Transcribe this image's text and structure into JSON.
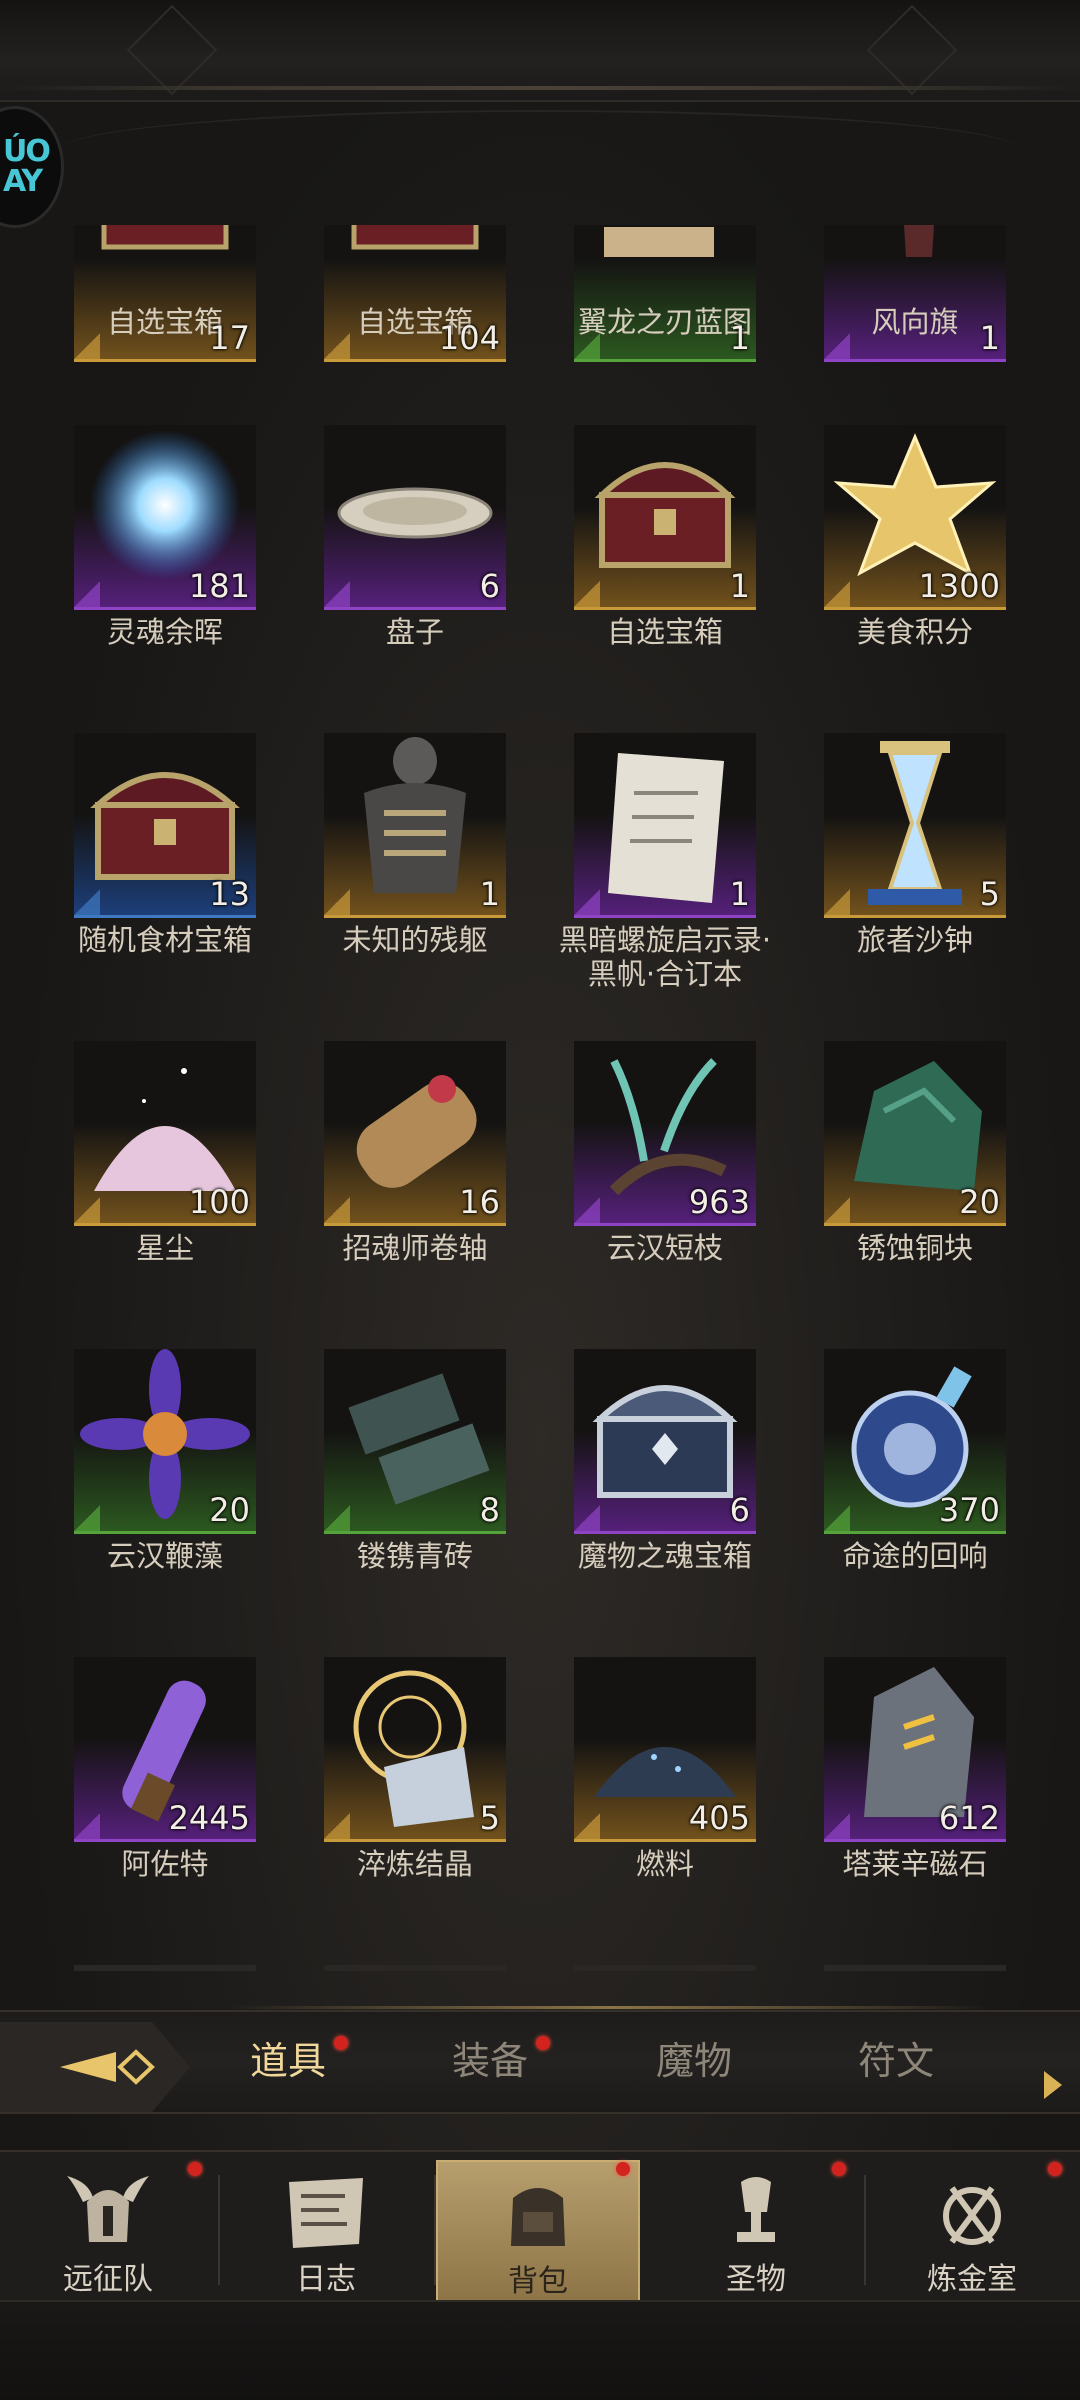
{
  "colors": {
    "rarity_orange": "#c99a3a",
    "rarity_purple": "#8f43c5",
    "rarity_green": "#55a43b",
    "rarity_blue": "#3e79c2",
    "tab_active": "#f0d79a",
    "notification_dot": "#d2231f"
  },
  "inventory": {
    "rows": [
      [
        {
          "name": "自选宝箱",
          "count": "17",
          "rarity": "orange",
          "icon": "treasure-chest-icon"
        },
        {
          "name": "自选宝箱",
          "count": "104",
          "rarity": "orange",
          "icon": "treasure-chest-icon"
        },
        {
          "name": "翼龙之刃蓝图",
          "count": "1",
          "rarity": "green",
          "icon": "blueprint-scroll-icon"
        },
        {
          "name": "风向旗",
          "count": "1",
          "rarity": "purple",
          "icon": "wind-flag-icon"
        }
      ],
      [
        {
          "name": "灵魂余晖",
          "count": "181",
          "rarity": "purple",
          "icon": "soul-afterglow-icon"
        },
        {
          "name": "盘子",
          "count": "6",
          "rarity": "purple",
          "icon": "plate-icon"
        },
        {
          "name": "自选宝箱",
          "count": "1",
          "rarity": "orange",
          "icon": "treasure-chest-icon"
        },
        {
          "name": "美食积分",
          "count": "1300",
          "rarity": "orange",
          "icon": "gold-star-icon"
        }
      ],
      [
        {
          "name": "随机食材宝箱",
          "count": "13",
          "rarity": "blue",
          "icon": "treasure-chest-icon"
        },
        {
          "name": "未知的残躯",
          "count": "1",
          "rarity": "orange",
          "icon": "skeleton-torso-icon"
        },
        {
          "name": "黑暗螺旋启示录·黑帆·合订本",
          "count": "1",
          "rarity": "purple",
          "icon": "parchment-scroll-icon"
        },
        {
          "name": "旅者沙钟",
          "count": "5",
          "rarity": "orange",
          "icon": "hourglass-icon"
        }
      ],
      [
        {
          "name": "星尘",
          "count": "100",
          "rarity": "orange",
          "icon": "stardust-pile-icon"
        },
        {
          "name": "招魂师卷轴",
          "count": "16",
          "rarity": "orange",
          "icon": "rolled-scroll-icon"
        },
        {
          "name": "云汉短枝",
          "count": "963",
          "rarity": "purple",
          "icon": "branch-icon"
        },
        {
          "name": "锈蚀铜块",
          "count": "20",
          "rarity": "orange",
          "icon": "copper-ore-icon"
        }
      ],
      [
        {
          "name": "云汉鞭藻",
          "count": "20",
          "rarity": "green",
          "icon": "algae-flower-icon"
        },
        {
          "name": "镂镌青砖",
          "count": "8",
          "rarity": "green",
          "icon": "carved-brick-icon"
        },
        {
          "name": "魔物之魂宝箱",
          "count": "6",
          "rarity": "purple",
          "icon": "steel-chest-icon"
        },
        {
          "name": "命途的回响",
          "count": "370",
          "rarity": "green",
          "icon": "potion-orb-icon"
        }
      ],
      [
        {
          "name": "阿佐特",
          "count": "2445",
          "rarity": "purple",
          "icon": "crystal-vial-icon"
        },
        {
          "name": "淬炼结晶",
          "count": "5",
          "rarity": "orange",
          "icon": "rune-crystal-icon"
        },
        {
          "name": "燃料",
          "count": "405",
          "rarity": "orange",
          "icon": "fuel-pile-icon"
        },
        {
          "name": "塔莱辛磁石",
          "count": "612",
          "rarity": "purple",
          "icon": "lodestone-icon"
        }
      ]
    ]
  },
  "tabs": {
    "items": [
      {
        "label": "道具",
        "active": true,
        "dot": true
      },
      {
        "label": "装备",
        "active": false,
        "dot": true
      },
      {
        "label": "魔物",
        "active": false,
        "dot": false
      },
      {
        "label": "符文",
        "active": false,
        "dot": false
      }
    ]
  },
  "bottom_nav": {
    "items": [
      {
        "label": "远征队",
        "icon": "horned-helmet-icon",
        "active": false,
        "dot": true
      },
      {
        "label": "日志",
        "icon": "journal-map-icon",
        "active": false,
        "dot": false
      },
      {
        "label": "背包",
        "icon": "backpack-icon",
        "active": true,
        "dot": true
      },
      {
        "label": "圣物",
        "icon": "relic-chalice-icon",
        "active": false,
        "dot": true
      },
      {
        "label": "炼金室",
        "icon": "alchemy-icon",
        "active": false,
        "dot": true
      }
    ]
  }
}
